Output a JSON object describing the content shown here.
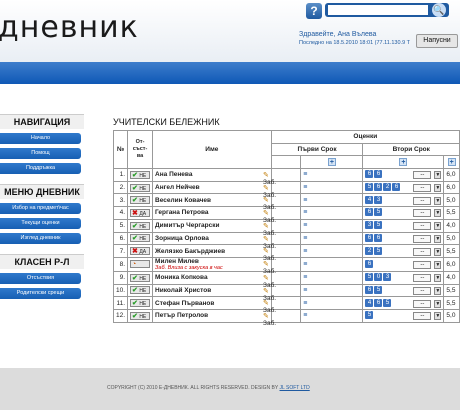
{
  "header": {
    "logo": "дневник",
    "search_placeholder": "",
    "greeting": "Здравейте, Ана Вълева",
    "last_login": "Последно на 18.5.2010 18:01 (77.11.130.9 Т",
    "logout_label": "Напусни"
  },
  "sidebar": {
    "sections": [
      {
        "title": "НАВИГАЦИЯ",
        "items": [
          "Начало",
          "Помощ",
          "Поддръжка"
        ]
      },
      {
        "title": "МЕНЮ ДНЕВНИК",
        "items": [
          "Избор на предмет\\час",
          "Текущи оценки",
          "Изглед дневник"
        ]
      },
      {
        "title": "КЛАСЕН Р-Л",
        "items": [
          "Отсъствия",
          "Родителски срещи"
        ]
      }
    ]
  },
  "main": {
    "title": "УЧИТЕЛСКИ БЕЛЕЖНИК",
    "headers": {
      "num": "№",
      "status_line1": "От-",
      "status_line2": "съст-",
      "status_line3": "ва",
      "name": "Име",
      "grades": "Оценки",
      "first_term": "Първи Срок",
      "second_term": "Втори Срок",
      "plus": "+"
    },
    "zab_label": "Заб.",
    "rows": [
      {
        "num": "1.",
        "status": "НЕ",
        "status_mark": "✔",
        "name": "Ана Пенева",
        "note": "",
        "grades": [
          "6",
          "6"
        ],
        "avg": "6,0"
      },
      {
        "num": "2.",
        "status": "НЕ",
        "status_mark": "✔",
        "name": "Ангел Нейчев",
        "note": "",
        "grades": [
          "5",
          "6",
          "2",
          "6"
        ],
        "avg": "6,0"
      },
      {
        "num": "3.",
        "status": "НЕ",
        "status_mark": "✔",
        "name": "Веселин Ковачев",
        "note": "",
        "grades": [
          "4",
          "3"
        ],
        "avg": "5,0"
      },
      {
        "num": "4.",
        "status": "ДА",
        "status_mark": "✖",
        "name": "Гергана Петрова",
        "note": "",
        "grades": [
          "6",
          "5"
        ],
        "avg": "5,5"
      },
      {
        "num": "5.",
        "status": "НЕ",
        "status_mark": "✔",
        "name": "Димитър Чергарски",
        "note": "",
        "grades": [
          "3",
          "5"
        ],
        "avg": "4,0"
      },
      {
        "num": "6.",
        "status": "НЕ",
        "status_mark": "✔",
        "name": "Зорница Орлова",
        "note": "",
        "grades": [
          "6",
          "6"
        ],
        "avg": "5,0"
      },
      {
        "num": "7.",
        "status": "ДА",
        "status_mark": "✖",
        "name": "Желязко Бакърджиев",
        "note": "",
        "grades": [
          "2",
          "5"
        ],
        "avg": "5,5"
      },
      {
        "num": "8.",
        "status": "",
        "status_mark": "◔",
        "name": "Милен Милев",
        "note": "Заб. Влиза с закуска в час",
        "grades": [
          "6"
        ],
        "avg": "6,0"
      },
      {
        "num": "9.",
        "status": "НЕ",
        "status_mark": "✔",
        "name": "Моника Копкова",
        "note": "",
        "grades": [
          "5",
          "0",
          "3"
        ],
        "avg": "4,0"
      },
      {
        "num": "10.",
        "status": "НЕ",
        "status_mark": "✔",
        "name": "Николай Христов",
        "note": "",
        "grades": [
          "6",
          "5"
        ],
        "avg": "5,5"
      },
      {
        "num": "11.",
        "status": "НЕ",
        "status_mark": "✔",
        "name": "Стефан Първанов",
        "note": "",
        "grades": [
          "4",
          "6",
          "5"
        ],
        "avg": "5,5"
      },
      {
        "num": "12.",
        "status": "НЕ",
        "status_mark": "✔",
        "name": "Петър Петролов",
        "note": "",
        "grades": [
          "5"
        ],
        "avg": "5,0"
      }
    ]
  },
  "footer": {
    "copyright": "COPYRIGHT (C) 2010 Е-ДНЕВНИК. ALL RIGHTS RESERVED. DESIGN BY",
    "design_link": "JL SOFT LTD"
  },
  "colors": {
    "accent": "#1f5aa0",
    "band": "#1560bd",
    "ok": "#2a9d2a",
    "absent": "#cc1111"
  }
}
